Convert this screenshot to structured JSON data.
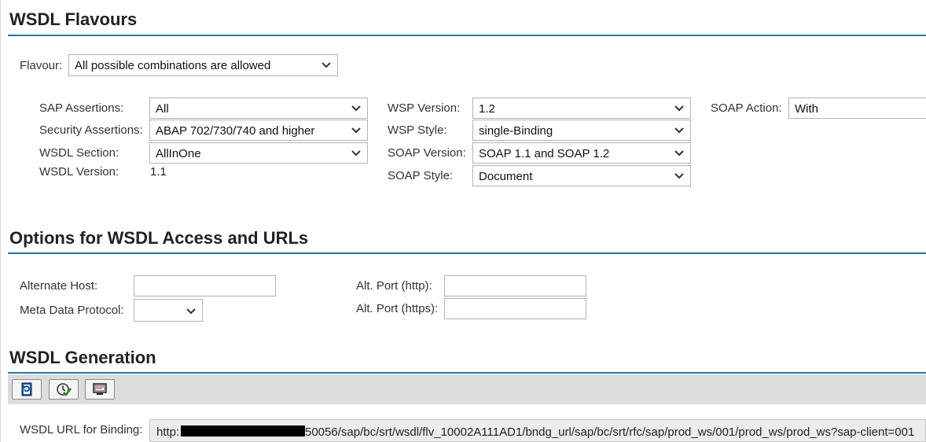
{
  "flavours": {
    "title": "WSDL Flavours",
    "flavour_label": "Flavour:",
    "flavour_value": "All possible combinations are allowed",
    "sap_assertions_label": "SAP Assertions:",
    "sap_assertions_value": "All",
    "security_assertions_label": "Security Assertions:",
    "security_assertions_value": "ABAP 702/730/740 and higher",
    "wsdl_section_label": "WSDL Section:",
    "wsdl_section_value": "AllInOne",
    "wsdl_version_label": "WSDL Version:",
    "wsdl_version_value": "1.1",
    "wsp_version_label": "WSP Version:",
    "wsp_version_value": "1.2",
    "wsp_style_label": "WSP Style:",
    "wsp_style_value": "single-Binding",
    "soap_version_label": "SOAP Version:",
    "soap_version_value": "SOAP 1.1 and SOAP 1.2",
    "soap_style_label": "SOAP Style:",
    "soap_style_value": "Document",
    "soap_action_label": "SOAP Action:",
    "soap_action_value": "With"
  },
  "access": {
    "title": "Options for WSDL Access and URLs",
    "alternate_host_label": "Alternate Host:",
    "alternate_host_value": "",
    "meta_data_protocol_label": "Meta Data Protocol:",
    "meta_data_protocol_value": "",
    "alt_port_http_label": "Alt. Port (http):",
    "alt_port_http_value": "",
    "alt_port_https_label": "Alt. Port (https):",
    "alt_port_https_value": ""
  },
  "generation": {
    "title": "WSDL Generation",
    "toolbar_icons": [
      "refresh-icon",
      "execute-icon",
      "display-icon"
    ],
    "url_label": "WSDL URL for Binding:",
    "url_prefix": "http:",
    "url_suffix": "50056/sap/bc/srt/wsdl/flv_10002A111AD1/bndg_url/sap/bc/srt/rfc/sap/prod_ws/001/prod_ws/prod_ws?sap-client=001"
  },
  "colors": {
    "section_line": "#1f78b4",
    "toolbar_bg": "#dcdcdc",
    "icon_blue": "#1c4ea8"
  }
}
